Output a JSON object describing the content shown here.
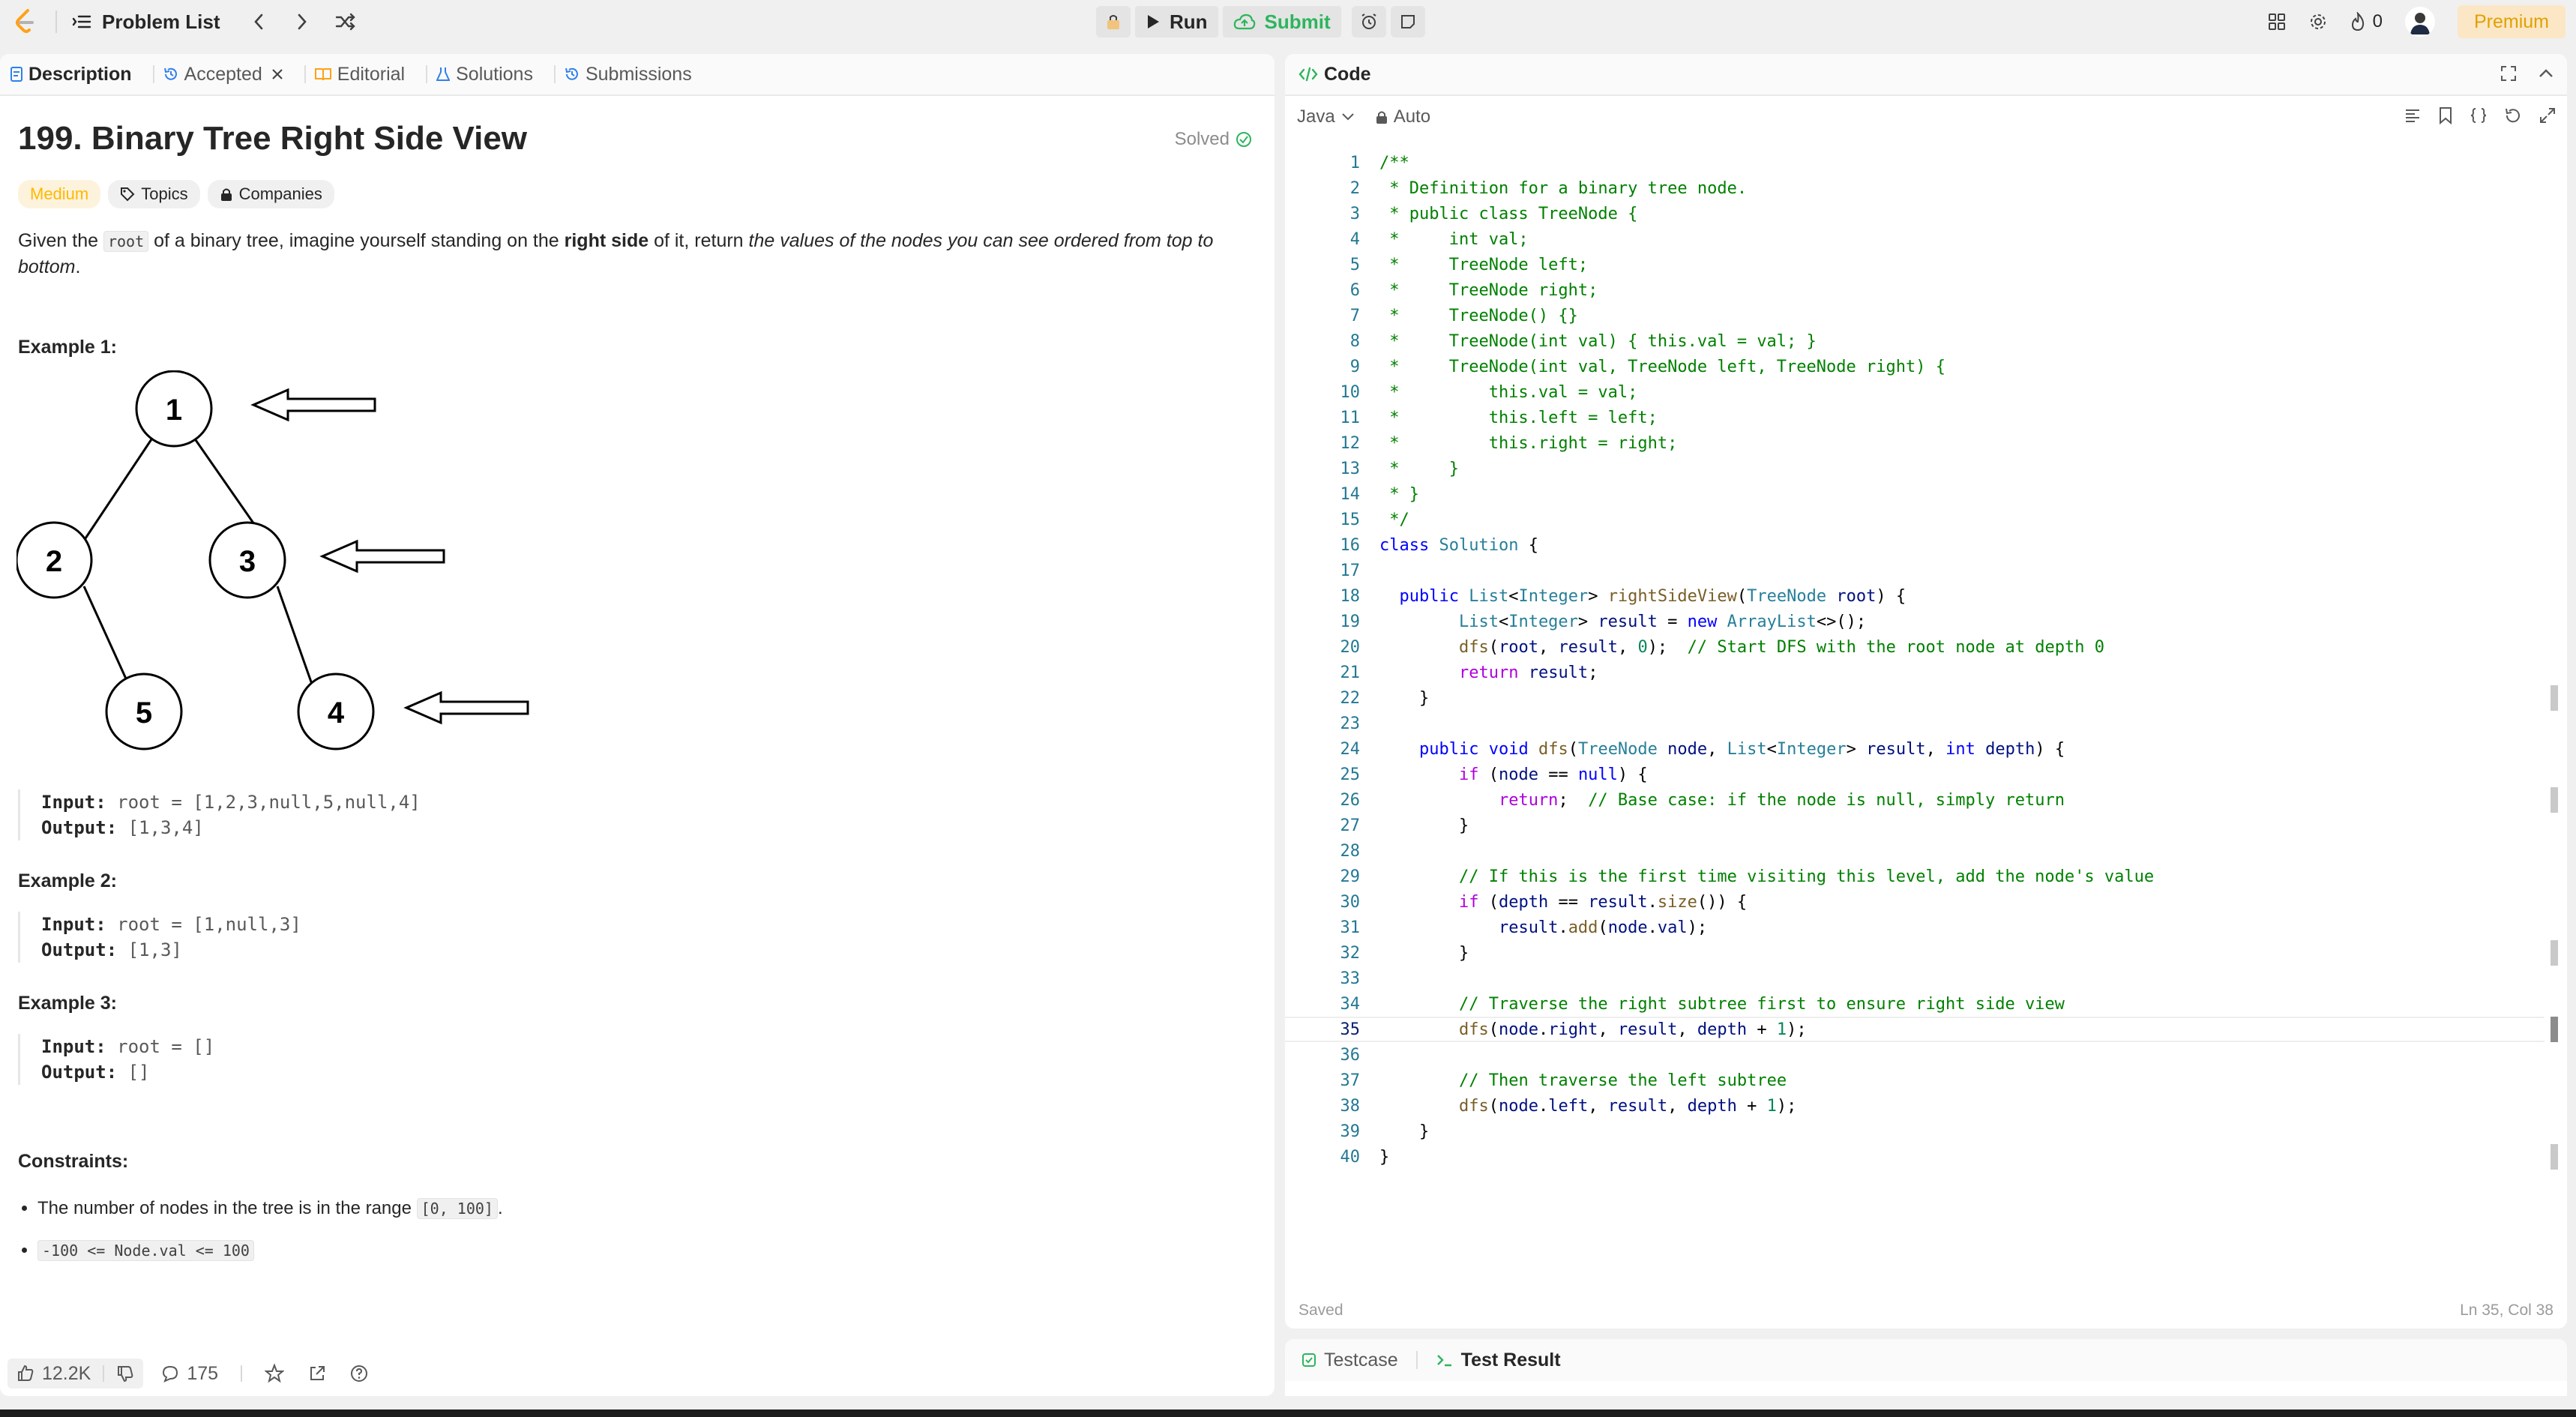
{
  "topbar": {
    "title": "Problem List",
    "run_label": "Run",
    "submit_label": "Submit",
    "streak_count": "0",
    "premium_label": "Premium"
  },
  "left_tabs": [
    {
      "label": "Description"
    },
    {
      "label": "Accepted"
    },
    {
      "label": "Editorial"
    },
    {
      "label": "Solutions"
    },
    {
      "label": "Submissions"
    }
  ],
  "problem": {
    "title": "199. Binary Tree Right Side View",
    "solved_label": "Solved",
    "difficulty": "Medium",
    "topics_label": "Topics",
    "companies_label": "Companies",
    "statement": {
      "p1": "Given the ",
      "code": "root",
      "p2": " of a binary tree, imagine yourself standing on the ",
      "bold": "right side",
      "p3": " of it, return ",
      "italic": "the values of the nodes you can see ordered from top to bottom",
      "p4": "."
    },
    "examples": [
      {
        "heading": "Example 1:",
        "input_label": "Input:",
        "input": "root = [1,2,3,null,5,null,4]",
        "output_label": "Output:",
        "output": "[1,3,4]"
      },
      {
        "heading": "Example 2:",
        "input_label": "Input:",
        "input": "root = [1,null,3]",
        "output_label": "Output:",
        "output": "[1,3]"
      },
      {
        "heading": "Example 3:",
        "input_label": "Input:",
        "input": "root = []",
        "output_label": "Output:",
        "output": "[]"
      }
    ],
    "tree_nodes": [
      "1",
      "2",
      "3",
      "5",
      "4"
    ],
    "constraints_heading": "Constraints:",
    "constraint1_text": "The number of nodes in the tree is in the range ",
    "constraint1_code": "[0, 100]",
    "constraint1_end": ".",
    "constraint2_code": "-100 <= Node.val <= 100"
  },
  "bottom": {
    "likes": "12.2K",
    "comments": "175"
  },
  "code_panel": {
    "title": "Code",
    "language": "Java",
    "mode": "Auto",
    "status": "Saved",
    "cursor": "Ln 35, Col 38",
    "current_line": 35
  },
  "test_panel": {
    "tab_testcase": "Testcase",
    "tab_result": "Test Result"
  },
  "colors": {
    "accent_green": "#2db55d",
    "medium": "#ffb800",
    "premium": "#e0a100"
  }
}
